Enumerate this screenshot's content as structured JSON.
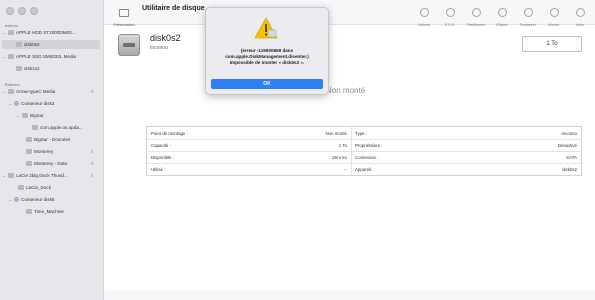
{
  "sidebar": {
    "section_internal": "Interne",
    "section_external": "Externe",
    "internal_items": [
      {
        "label": "APPLE HDD ST1000DM00...",
        "level": 0
      },
      {
        "label": "disk0s2",
        "level": 1
      },
      {
        "label": "APPLE SSD SM0032L Media",
        "level": 0
      },
      {
        "label": "disk1s2",
        "level": 1
      }
    ],
    "external_items": [
      {
        "label": "Arrow-typeC Media",
        "level": 0
      },
      {
        "label": "Conteneur disk3",
        "level": 1
      },
      {
        "label": "BigSur",
        "level": 2
      },
      {
        "label": "com.apple.os.upda...",
        "level": 3
      },
      {
        "label": "BigSur - Données",
        "level": 2
      },
      {
        "label": "Monterey",
        "level": 2
      },
      {
        "label": "Monterey - Data",
        "level": 2
      },
      {
        "label": "LaCie 2big Dock Thund...",
        "level": 0
      },
      {
        "label": "LaCie_Dock",
        "level": 1
      },
      {
        "label": "Conteneur disk5",
        "level": 1
      },
      {
        "label": "Time_Machine",
        "level": 2
      }
    ]
  },
  "toolbar": {
    "presentation_label": "Présentation",
    "title": "Utilitaire de disque",
    "actions": [
      "Volume",
      "S.O.S.",
      "Partitionner",
      "Effacer",
      "Restaurer",
      "Monter",
      "Infos"
    ]
  },
  "main": {
    "disk_name": "disk0s2",
    "disk_sub": "Inconnu",
    "size_button": "1 To",
    "unmounted_label": "Non monté"
  },
  "info": {
    "left": [
      {
        "label": "Point de montage :",
        "value": "Non monté"
      },
      {
        "label": "Capacité :",
        "value": "1 To"
      },
      {
        "label": "Disponible :",
        "value": "Zéro ko"
      },
      {
        "label": "Utilisé :",
        "value": "--"
      }
    ],
    "right": [
      {
        "label": "Type :",
        "value": "Inconnu"
      },
      {
        "label": "Propriétaires :",
        "value": "Désactivé"
      },
      {
        "label": "Connexion :",
        "value": "SATA"
      },
      {
        "label": "Appareil :",
        "value": "disk0s2"
      }
    ]
  },
  "dialog": {
    "message_line1": "(erreur -119930868 dans",
    "message_line2": "com.apple.DiskManagement.disenter.)",
    "message_line3": "Impossible de monter « disk0s2 ».",
    "ok_label": "OK"
  },
  "colors": {
    "accent": "#2f7ff2",
    "sidebar_bg": "#e8e6ea",
    "warning": "#f5c400"
  }
}
